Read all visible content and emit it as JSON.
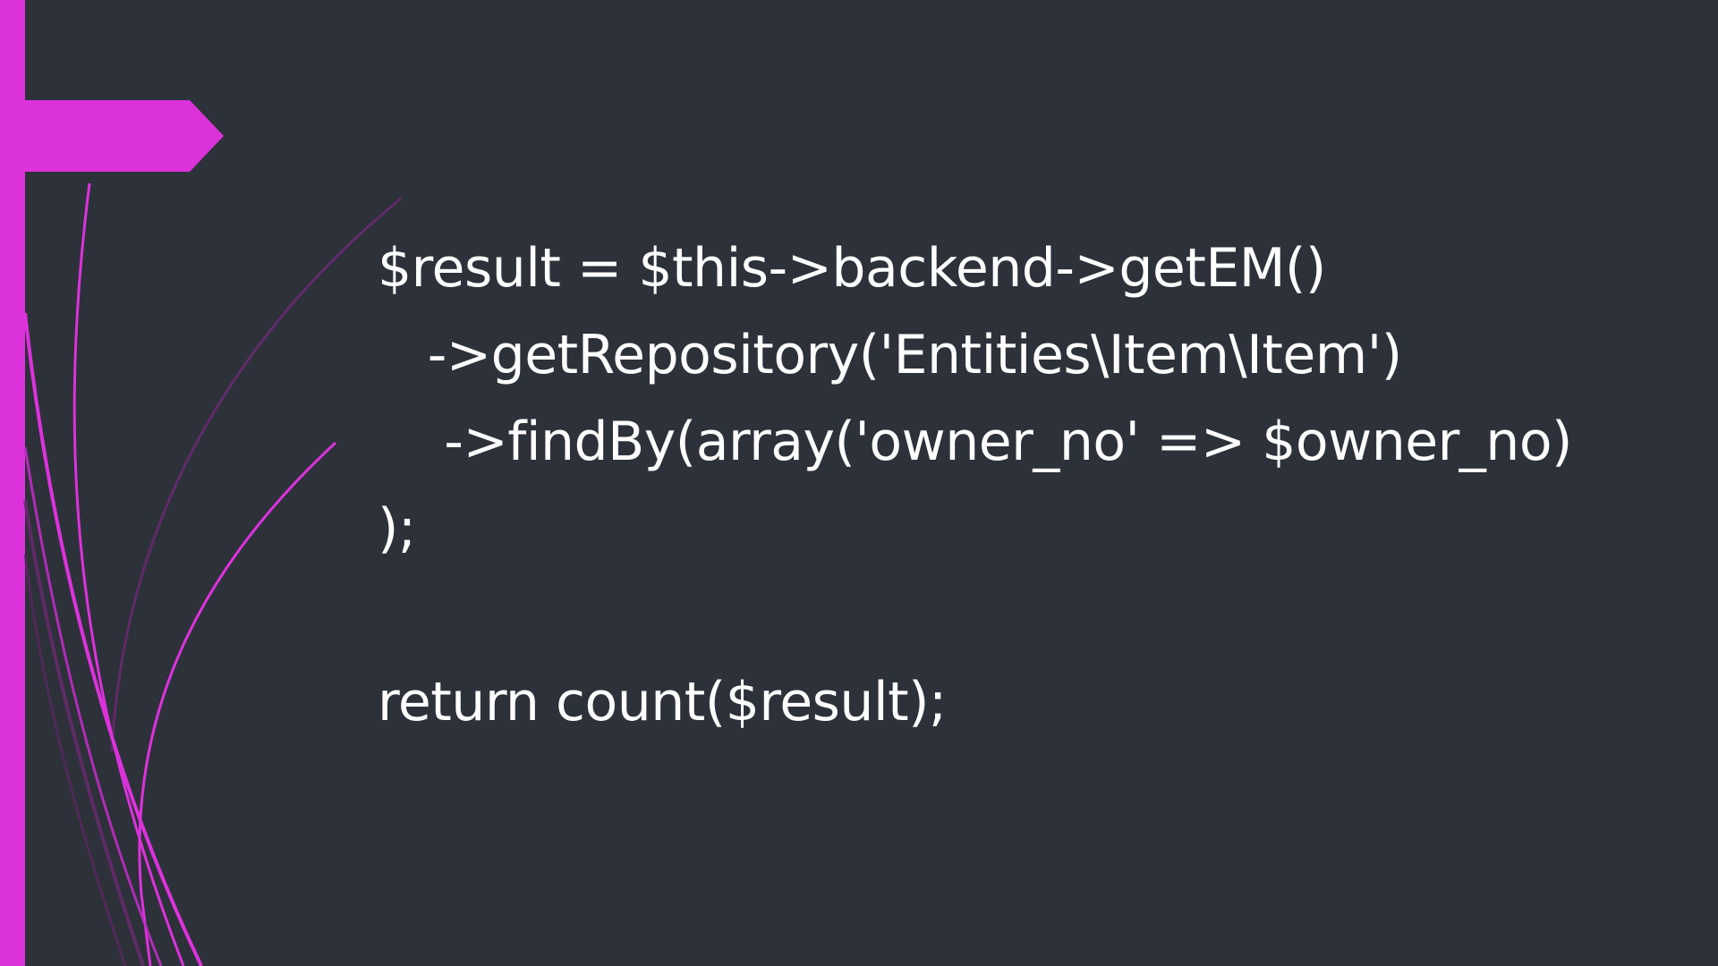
{
  "slide": {
    "accent_color": "#dc32dc",
    "background_color": "#2d3139",
    "text_color": "#ffffff",
    "code_lines": [
      "$result = $this->backend->getEM()",
      "   ->getRepository('Entities\\Item\\Item')",
      "    ->findBy(array('owner_no' => $owner_no)",
      ");",
      "",
      "return count($result);"
    ]
  }
}
